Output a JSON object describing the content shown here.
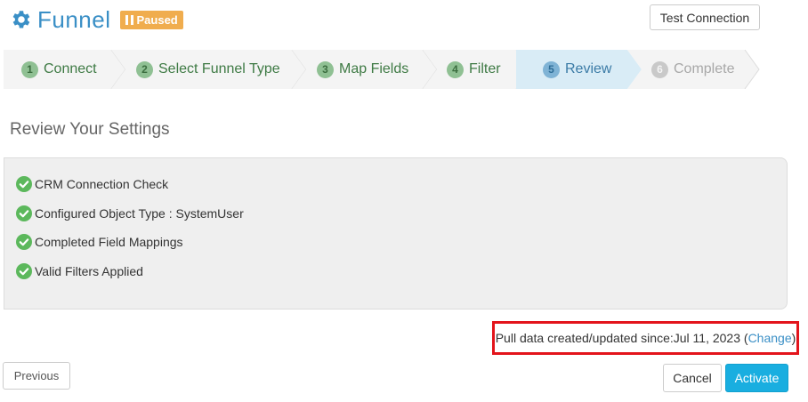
{
  "header": {
    "title": "Funnel",
    "status_badge": "Paused",
    "gear_icon": "gear-icon",
    "test_connection_label": "Test Connection",
    "colors": {
      "title": "#3a8fc6",
      "badge": "#f0ad4e"
    }
  },
  "steps": [
    {
      "num": "1",
      "label": "Connect",
      "state": "done"
    },
    {
      "num": "2",
      "label": "Select Funnel Type",
      "state": "done"
    },
    {
      "num": "3",
      "label": "Map Fields",
      "state": "done"
    },
    {
      "num": "4",
      "label": "Filter",
      "state": "done"
    },
    {
      "num": "5",
      "label": "Review",
      "state": "active"
    },
    {
      "num": "6",
      "label": "Complete",
      "state": "pending"
    }
  ],
  "review": {
    "title": "Review Your Settings",
    "checks": [
      {
        "label": "CRM Connection Check",
        "icon": "check-circle-icon"
      },
      {
        "label": "Configured Object Type : SystemUser",
        "icon": "check-circle-icon"
      },
      {
        "label": "Completed Field Mappings",
        "icon": "check-circle-icon"
      },
      {
        "label": "Valid Filters Applied",
        "icon": "check-circle-icon"
      }
    ]
  },
  "pull": {
    "prefix": "Pull data created/updated since:",
    "date": "Jul 11, 2023",
    "open_paren": " (",
    "change_label": "Change",
    "close_paren": ")"
  },
  "footer": {
    "previous_label": "Previous",
    "cancel_label": "Cancel",
    "activate_label": "Activate",
    "colors": {
      "activate": "#19aee0"
    }
  }
}
